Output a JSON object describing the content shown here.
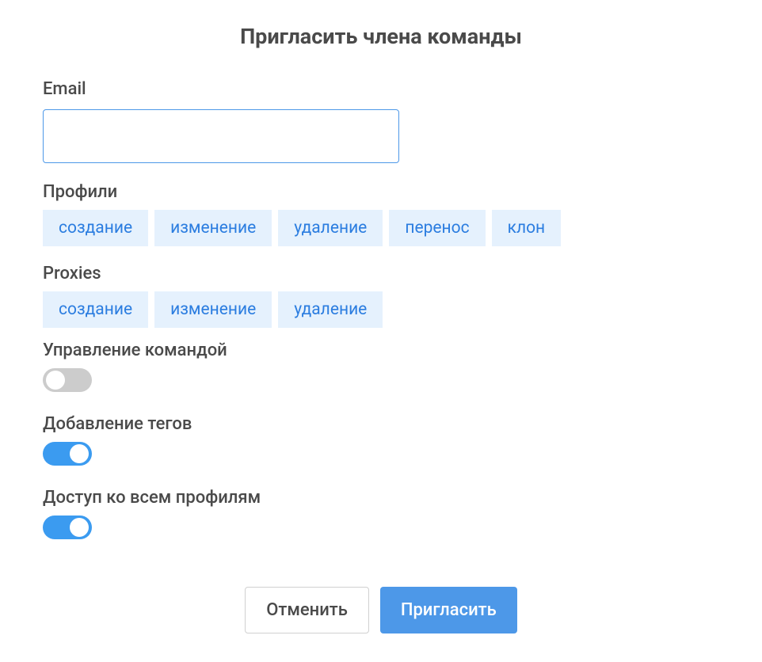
{
  "dialog": {
    "title": "Пригласить члена команды"
  },
  "email": {
    "label": "Email",
    "value": ""
  },
  "profiles": {
    "label": "Профили",
    "tags": [
      "создание",
      "изменение",
      "удаление",
      "перенос",
      "клон"
    ]
  },
  "proxies": {
    "label": "Proxies",
    "tags": [
      "создание",
      "изменение",
      "удаление"
    ]
  },
  "teamManagement": {
    "label": "Управление командой",
    "enabled": false
  },
  "addTags": {
    "label": "Добавление тегов",
    "enabled": true
  },
  "allProfilesAccess": {
    "label": "Доступ ко всем профилям",
    "enabled": true
  },
  "buttons": {
    "cancel": "Отменить",
    "invite": "Пригласить"
  }
}
